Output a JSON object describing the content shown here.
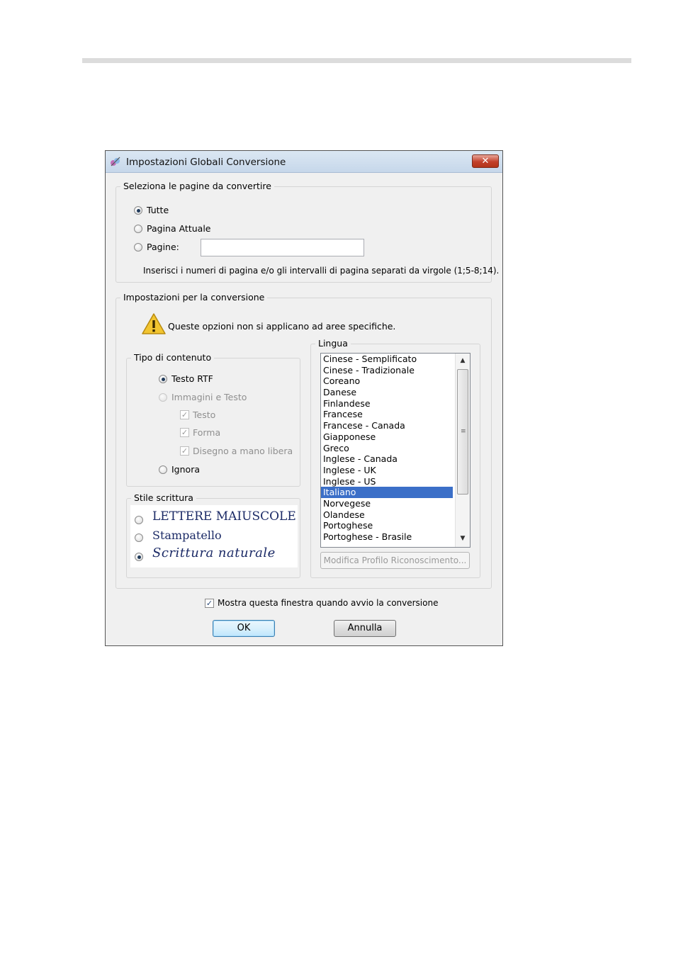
{
  "dialog": {
    "title": "Impostazioni Globali Conversione",
    "close_label": "✕"
  },
  "pages_group": {
    "title": "Seleziona le pagine da convertire",
    "options": [
      "Tutte",
      "Pagina Attuale",
      "Pagine:"
    ],
    "selected": "Tutte",
    "pages_input_value": "",
    "hint": "Inserisci i numeri di pagina e/o gli intervalli di pagina separati da virgole (1;5-8;14)."
  },
  "conversion_group": {
    "title": "Impostazioni per la conversione",
    "warning_text": "Queste opzioni non si applicano ad aree specifiche.",
    "content_type": {
      "title": "Tipo di contenuto",
      "rtf": "Testo RTF",
      "images_text": "Immagini e Testo",
      "text": "Testo",
      "form": "Forma",
      "freehand": "Disegno a mano libera",
      "ignore": "Ignora",
      "selected": "Testo RTF"
    },
    "writing_style": {
      "title": "Stile scrittura",
      "caps": "LETTERE MAIUSCOLE",
      "print": "Stampatello",
      "cursive": "Scrittura naturale",
      "selected": "Scrittura naturale"
    },
    "language": {
      "title": "Lingua",
      "items": [
        "Cinese - Semplificato",
        "Cinese - Tradizionale",
        "Coreano",
        "Danese",
        "Finlandese",
        "Francese",
        "Francese - Canada",
        "Giapponese",
        "Greco",
        "Inglese - Canada",
        "Inglese - UK",
        "Inglese - US",
        "Italiano",
        "Norvegese",
        "Olandese",
        "Portoghese",
        "Portoghese - Brasile"
      ],
      "selected": "Italiano",
      "modify_button": "Modifica Profilo Riconoscimento..."
    }
  },
  "footer": {
    "show_checkbox": "Mostra questa finestra quando avvio la conversione",
    "show_checked": true,
    "ok": "OK",
    "cancel": "Annulla"
  },
  "colors": {
    "selection": "#3b6fc8",
    "close_button": "#c2402a",
    "handwriting": "#1b2a66"
  }
}
